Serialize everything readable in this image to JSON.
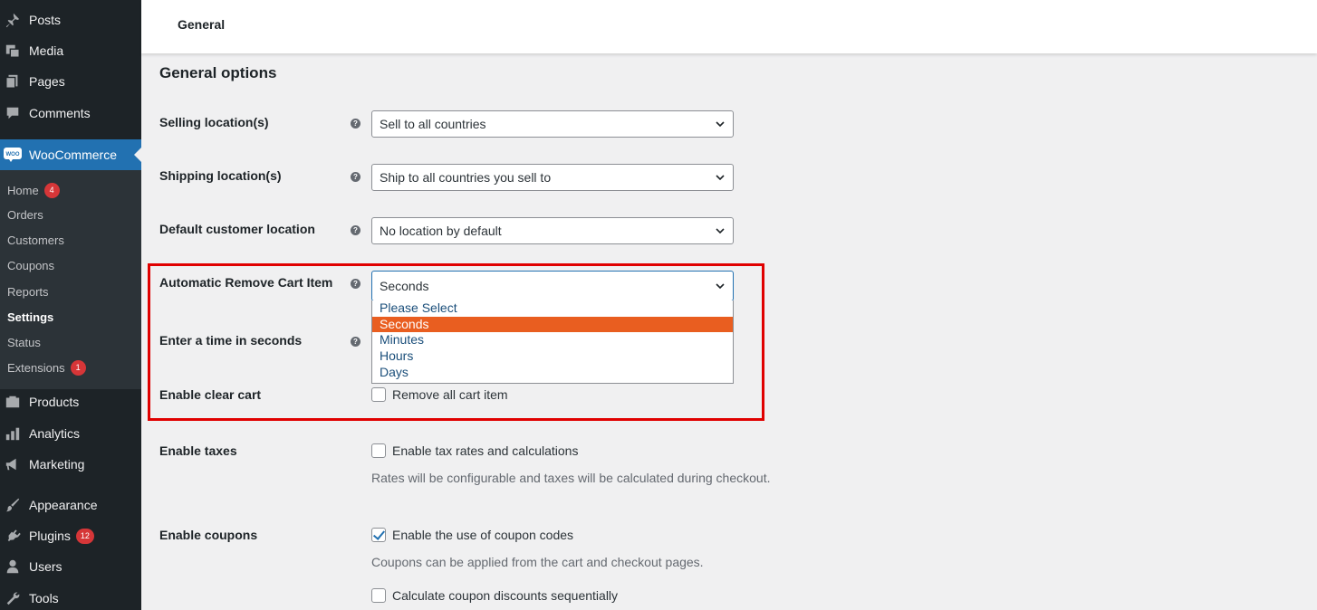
{
  "sidebar": {
    "top_items": [
      {
        "label": "Posts",
        "icon": "pin-icon"
      },
      {
        "label": "Media",
        "icon": "media-icon"
      },
      {
        "label": "Pages",
        "icon": "pages-icon"
      },
      {
        "label": "Comments",
        "icon": "comments-icon"
      }
    ],
    "woocommerce": {
      "label": "WooCommerce",
      "icon": "woo-icon",
      "icon_text": "WOO"
    },
    "submenu": [
      {
        "label": "Home",
        "badge": "4"
      },
      {
        "label": "Orders"
      },
      {
        "label": "Customers"
      },
      {
        "label": "Coupons"
      },
      {
        "label": "Reports"
      },
      {
        "label": "Settings",
        "current": true
      },
      {
        "label": "Status"
      },
      {
        "label": "Extensions",
        "badge": "1"
      }
    ],
    "bottom_items": [
      {
        "label": "Products",
        "icon": "products-icon"
      },
      {
        "label": "Analytics",
        "icon": "analytics-icon"
      },
      {
        "label": "Marketing",
        "icon": "megaphone-icon"
      },
      {
        "label": "Appearance",
        "icon": "brush-icon"
      },
      {
        "label": "Plugins",
        "icon": "plugin-icon",
        "badge": "12"
      },
      {
        "label": "Users",
        "icon": "user-icon"
      },
      {
        "label": "Tools",
        "icon": "wrench-icon"
      }
    ]
  },
  "header": {
    "tab": "General"
  },
  "main": {
    "section_title": "General options",
    "selling": {
      "label": "Selling location(s)",
      "value": "Sell to all countries"
    },
    "shipping": {
      "label": "Shipping location(s)",
      "value": "Ship to all countries you sell to"
    },
    "customer": {
      "label": "Default customer location",
      "value": "No location by default"
    },
    "remove_cart": {
      "label": "Automatic Remove Cart Item",
      "value": "Seconds",
      "options": [
        "Please Select",
        "Seconds",
        "Minutes",
        "Hours",
        "Days"
      ],
      "selected": "Seconds"
    },
    "time_seconds": {
      "label": "Enter a time in seconds"
    },
    "clear_cart": {
      "label": "Enable clear cart",
      "checkbox_label": "Remove all cart item",
      "checked": false
    },
    "taxes": {
      "label": "Enable taxes",
      "checkbox_label": "Enable tax rates and calculations",
      "checked": false,
      "description": "Rates will be configurable and taxes will be calculated during checkout."
    },
    "coupons": {
      "label": "Enable coupons",
      "checkbox_label": "Enable the use of coupon codes",
      "checked": true,
      "description": "Coupons can be applied from the cart and checkout pages."
    },
    "sequential": {
      "checkbox_label": "Calculate coupon discounts sequentially",
      "checked": false
    },
    "help_glyph": "?"
  },
  "colors": {
    "accent": "#2271b1",
    "highlight_border": "#e00000",
    "option_selected": "#e95e20",
    "sidebar": "#1d2327"
  }
}
